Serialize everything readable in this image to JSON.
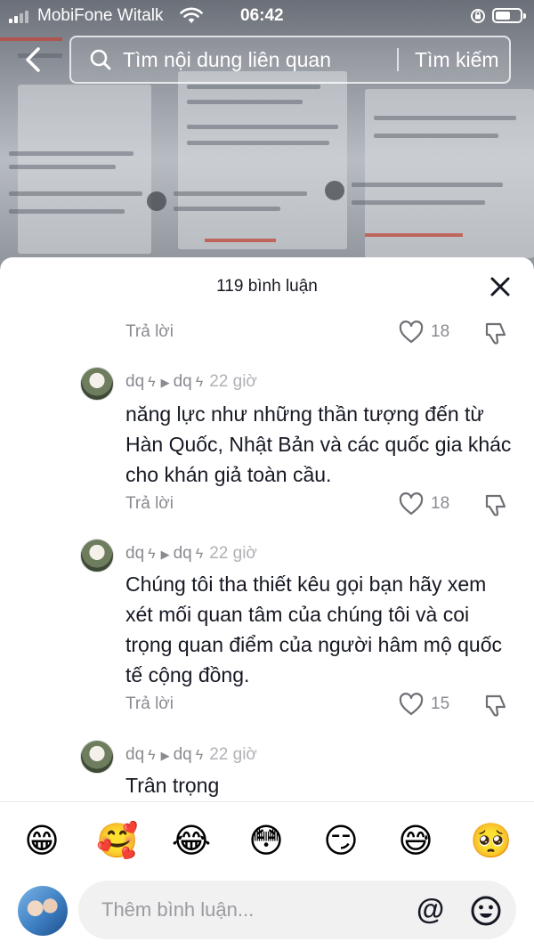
{
  "status_bar": {
    "carrier": "MobiFone Witalk",
    "time": "06:42"
  },
  "top_bar": {
    "search_placeholder": "Tìm nội dung liên quan",
    "search_button": "Tìm kiếm"
  },
  "comments_panel": {
    "title": "119 bình luận"
  },
  "first_reply_row": {
    "reply_label": "Trả lời",
    "likes": "18"
  },
  "comments": [
    {
      "user": "dq",
      "reply_to": "dq",
      "time": "22 giờ",
      "text": "năng lực như những thần tượng đến từ Hàn Quốc, Nhật Bản và các quốc gia khác cho khán giả toàn cầu.",
      "reply_label": "Trả lời",
      "likes": "18"
    },
    {
      "user": "dq",
      "reply_to": "dq",
      "time": "22 giờ",
      "text": "Chúng tôi tha thiết kêu gọi bạn hãy xem xét mối quan tâm của chúng tôi và coi trọng quan điểm của người hâm mộ quốc tế cộng đồng.",
      "reply_label": "Trả lời",
      "likes": "15"
    },
    {
      "user": "dq",
      "reply_to": "dq",
      "time": "22 giờ",
      "text": "Trân trọng"
    }
  ],
  "emoji_bar": [
    "😁",
    "🥰",
    "😂",
    "😳",
    "😏",
    "😅",
    "🥺"
  ],
  "comment_input": {
    "placeholder": "Thêm bình luận...",
    "mention_label": "@"
  }
}
